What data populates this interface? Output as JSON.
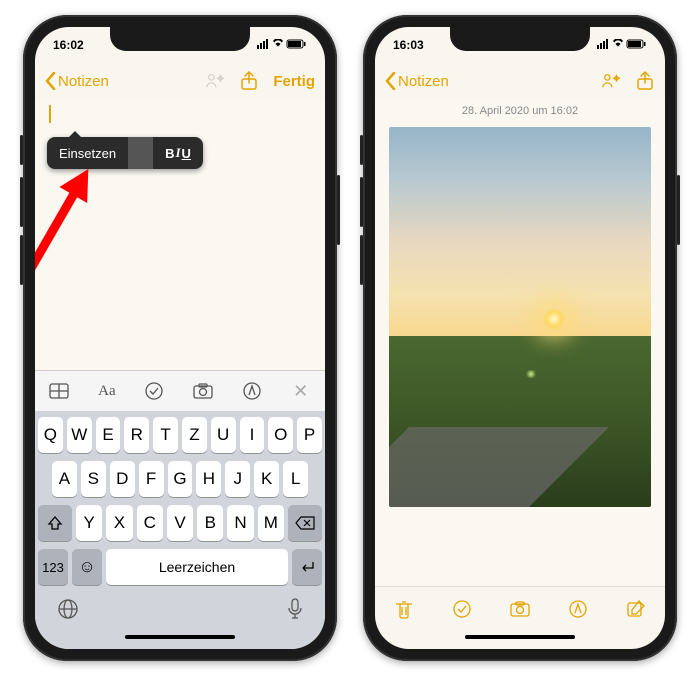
{
  "phone1": {
    "status": {
      "time": "16:02"
    },
    "nav": {
      "back": "Notizen",
      "done": "Fertig"
    },
    "tooltip": {
      "paste": "Einsetzen",
      "format": "BIU"
    },
    "kbd_tools": {
      "aa": "Aa"
    },
    "keyboard": {
      "row1": [
        "Q",
        "W",
        "E",
        "R",
        "T",
        "Z",
        "U",
        "I",
        "O",
        "P"
      ],
      "row2": [
        "A",
        "S",
        "D",
        "F",
        "G",
        "H",
        "J",
        "K",
        "L"
      ],
      "row3": [
        "Y",
        "X",
        "C",
        "V",
        "B",
        "N",
        "M"
      ],
      "numkey": "123",
      "space": "Leerzeichen"
    }
  },
  "phone2": {
    "status": {
      "time": "16:03"
    },
    "nav": {
      "back": "Notizen"
    },
    "timestamp": "28. April 2020 um 16:02"
  }
}
